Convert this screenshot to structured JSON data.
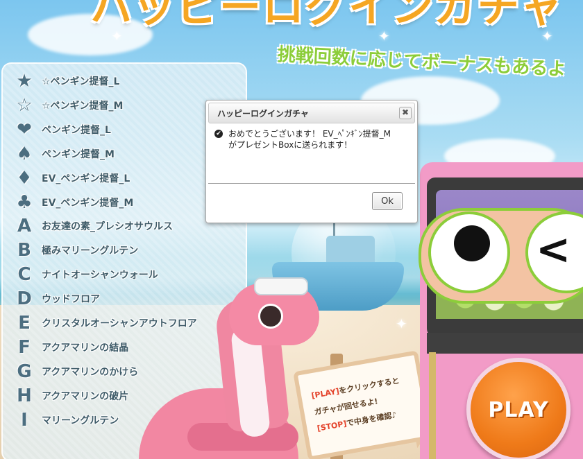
{
  "game": {
    "title": "ハッピーログインガチャ",
    "subtitle": "挑戦回数に応じてボーナスもあるよ"
  },
  "prizes": [
    {
      "mark": "★",
      "icon": "star-filled-icon",
      "label": "☆ペンギン提督_L"
    },
    {
      "mark": "☆",
      "icon": "star-outline-icon",
      "label": "☆ペンギン提督_M"
    },
    {
      "mark": "❤",
      "icon": "heart-icon",
      "label": "ペンギン提督_L"
    },
    {
      "mark": "♠",
      "icon": "spade-icon",
      "label": "ペンギン提督_M"
    },
    {
      "mark": "♦",
      "icon": "diamond-icon",
      "label": "EV_ペンギン提督_L"
    },
    {
      "mark": "♣",
      "icon": "club-icon",
      "label": "EV_ペンギン提督_M"
    },
    {
      "mark": "A",
      "icon": "letter-a-icon",
      "label": "お友達の素_プレシオサウルス"
    },
    {
      "mark": "B",
      "icon": "letter-b-icon",
      "label": "極みマリーングルテン"
    },
    {
      "mark": "C",
      "icon": "letter-c-icon",
      "label": "ナイトオーシャンウォール"
    },
    {
      "mark": "D",
      "icon": "letter-d-icon",
      "label": "ウッドフロア"
    },
    {
      "mark": "E",
      "icon": "letter-e-icon",
      "label": "クリスタルオーシャンアウトフロア"
    },
    {
      "mark": "F",
      "icon": "letter-f-icon",
      "label": "アクアマリンの結晶"
    },
    {
      "mark": "G",
      "icon": "letter-g-icon",
      "label": "アクアマリンのかけら"
    },
    {
      "mark": "H",
      "icon": "letter-h-icon",
      "label": "アクアマリンの破片"
    },
    {
      "mark": "I",
      "icon": "letter-i-icon",
      "label": "マリーングルテン"
    }
  ],
  "sign": {
    "line1_highlight": "[PLAY]",
    "line1_rest": "をクリックすると",
    "line2": "ガチャが回せるよ!",
    "line3_highlight": "[STOP]",
    "line3_rest": "で中身を確認♪"
  },
  "play_button": {
    "label": "PLAY"
  },
  "dialog": {
    "title": "ハッピーログインガチャ",
    "close_glyph": "✖",
    "check_glyph": "✔",
    "message": "おめでとうございます！ EV_ﾍﾟﾝｷﾞﾝ提督_M がプレゼントBoxに送られます！",
    "ok_label": "Ok"
  },
  "colors": {
    "title_orange": "#f5a623",
    "subtitle_green": "#8ccd3a",
    "dino_pink": "#f287a2",
    "machine_pink": "#f29bc7",
    "play_orange": "#ef7a19"
  }
}
